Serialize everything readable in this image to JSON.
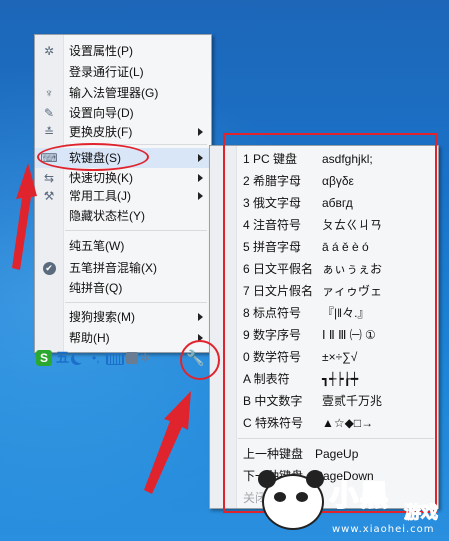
{
  "menu": {
    "items": [
      {
        "label": "设置属性(P)",
        "icon": "gear-icon",
        "arrow": false
      },
      {
        "label": "登录通行证(L)",
        "icon": "",
        "arrow": false
      },
      {
        "label": "输入法管理器(G)",
        "icon": "tools-icon",
        "arrow": false
      },
      {
        "label": "设置向导(D)",
        "icon": "brush-icon",
        "arrow": false
      },
      {
        "label": "更换皮肤(F)",
        "icon": "skin-icon",
        "arrow": true
      },
      {
        "label": "软键盘(S)",
        "icon": "keyboard-icon",
        "arrow": true
      },
      {
        "label": "快速切换(K)",
        "icon": "switch-icon",
        "arrow": true
      },
      {
        "label": "常用工具(J)",
        "icon": "wrench-icon",
        "arrow": true
      },
      {
        "label": "隐藏状态栏(Y)",
        "icon": "",
        "arrow": false
      },
      {
        "label": "纯五笔(W)",
        "icon": "",
        "arrow": false
      },
      {
        "label": "五笔拼音混输(X)",
        "icon": "check-icon",
        "arrow": false
      },
      {
        "label": "纯拼音(Q)",
        "icon": "",
        "arrow": false
      },
      {
        "label": "搜狗搜索(M)",
        "icon": "",
        "arrow": true
      },
      {
        "label": "帮助(H)",
        "icon": "",
        "arrow": true
      }
    ],
    "toolbar": {
      "s": "S",
      "wu": "五",
      "dot": "•,"
    }
  },
  "keyboard_submenu": {
    "items": [
      {
        "label": "1 PC 键盘",
        "value": "asdfghjkl;"
      },
      {
        "label": "2 希腊字母",
        "value": "αβγδε"
      },
      {
        "label": "3 俄文字母",
        "value": "абвгд"
      },
      {
        "label": "4 注音符号",
        "value": "ㄆㄊㄍㄐㄢ"
      },
      {
        "label": "5 拼音字母",
        "value": "ā á ě è ó"
      },
      {
        "label": "6 日文平假名",
        "value": "ぁぃぅぇお"
      },
      {
        "label": "7 日文片假名",
        "value": "ァィゥヴェ"
      },
      {
        "label": "8 标点符号",
        "value": "『|‖々.』"
      },
      {
        "label": "9 数字序号",
        "value": "Ⅰ Ⅱ Ⅲ ㈠ ①"
      },
      {
        "label": "0 数学符号",
        "value": "±×÷∑√"
      },
      {
        "label": "A 制表符",
        "value": "┓┽┝┟┿"
      },
      {
        "label": "B 中文数字",
        "value": "壹贰千万兆"
      },
      {
        "label": "C 特殊符号",
        "value": "▲☆◆□→"
      },
      {
        "label": "上一种键盘",
        "value": "PageUp"
      },
      {
        "label": "下一种键盘",
        "value": "PageDown"
      },
      {
        "label": "关闭软键盘",
        "value": ""
      }
    ]
  },
  "watermark": {
    "brand": "小黑",
    "game": "游戏",
    "url": "www.xiaohei.com"
  },
  "colors": {
    "annotation": "#e0242d",
    "desktop": "#1a73c9",
    "menu_bg": "#f5f6f7"
  }
}
